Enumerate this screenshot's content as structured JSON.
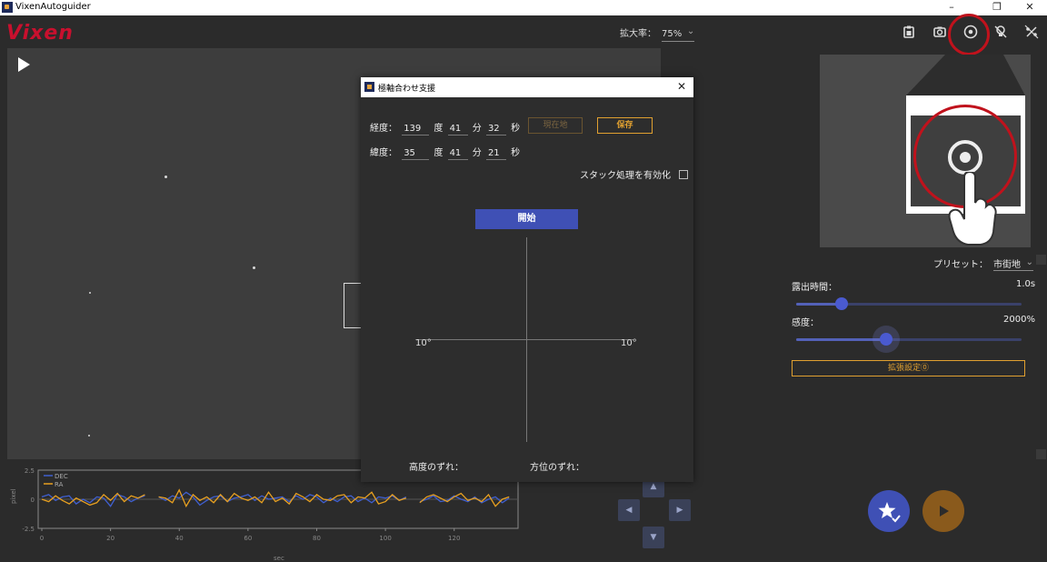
{
  "window": {
    "title": "VixenAutoguider",
    "minimize": "–",
    "maximize": "❐",
    "close": "✕"
  },
  "brand": {
    "logo": "Vixen",
    "color": "#c8102e"
  },
  "zoom": {
    "label": "拡大率：",
    "value": "75%"
  },
  "toolbar": {
    "icons": [
      "clipboard-icon",
      "camera-rotate-icon",
      "target-icon",
      "lightbulb-off-icon",
      "percent-slash-icon"
    ]
  },
  "graph": {
    "legend": [
      "DEC",
      "RA"
    ],
    "ylabel": "pixel",
    "xlabel": "sec",
    "yticks": [
      "2.5",
      "0",
      "-2.5"
    ],
    "xticks": [
      "0",
      "20",
      "40",
      "60",
      "80",
      "100",
      "120"
    ],
    "colors": {
      "DEC": "#3f5fd0",
      "RA": "#e8a020"
    }
  },
  "chart_data": {
    "type": "line",
    "xlabel": "sec",
    "ylabel": "pixel",
    "ylim": [
      -2.5,
      2.5
    ],
    "xlim": [
      0,
      137
    ],
    "series": [
      {
        "name": "DEC",
        "x": [
          0,
          2,
          4,
          6,
          8,
          10,
          12,
          14,
          16,
          18,
          20,
          22,
          24,
          26,
          28,
          30,
          34,
          36,
          38,
          40,
          42,
          44,
          46,
          48,
          50,
          52,
          54,
          56,
          58,
          60,
          62,
          64,
          66,
          68,
          70,
          72,
          74,
          76,
          78,
          80,
          82,
          84,
          86,
          88,
          90,
          92,
          94,
          96,
          98,
          100,
          102,
          104,
          106,
          110,
          112,
          114,
          116,
          118,
          120,
          122,
          124,
          126,
          128,
          130,
          132,
          134,
          136
        ],
        "values": [
          0.2,
          0.4,
          -0.1,
          0.2,
          0.3,
          -0.4,
          0.0,
          -0.3,
          0.2,
          0.1,
          -0.6,
          0.4,
          0.2,
          -0.2,
          0.1,
          0.3,
          0.2,
          -0.1,
          0.3,
          0.1,
          0.6,
          0.2,
          -0.5,
          -0.1,
          0.2,
          0.3,
          -0.2,
          0.1,
          0.2,
          0.4,
          -0.1,
          0.3,
          0.0,
          0.1,
          0.2,
          -0.2,
          0.3,
          0.0,
          0.4,
          0.2,
          -0.3,
          0.1,
          -0.2,
          0.2,
          0.3,
          -0.2,
          0.1,
          -0.3,
          0.2,
          0.1,
          0.3,
          -0.1,
          0.2,
          -0.2,
          0.0,
          0.3,
          -0.2,
          -0.1,
          0.3,
          0.0,
          -0.2,
          0.2,
          -0.3,
          0.0,
          0.2,
          -0.3,
          0.1
        ]
      },
      {
        "name": "RA",
        "x": [
          0,
          2,
          4,
          6,
          8,
          10,
          12,
          14,
          16,
          18,
          20,
          22,
          24,
          26,
          28,
          30,
          34,
          36,
          38,
          40,
          42,
          44,
          46,
          48,
          50,
          52,
          54,
          56,
          58,
          60,
          62,
          64,
          66,
          68,
          70,
          72,
          74,
          76,
          78,
          80,
          82,
          84,
          86,
          88,
          90,
          92,
          94,
          96,
          98,
          100,
          102,
          104,
          106,
          110,
          112,
          114,
          116,
          118,
          120,
          122,
          124,
          126,
          128,
          130,
          132,
          134,
          136
        ],
        "values": [
          0.0,
          -0.2,
          0.3,
          -0.1,
          -0.4,
          0.1,
          -0.2,
          -0.5,
          -0.3,
          0.4,
          -0.1,
          0.5,
          -0.2,
          0.3,
          0.1,
          0.4,
          0.2,
          0.1,
          -0.3,
          0.8,
          -0.6,
          0.4,
          -0.1,
          0.2,
          -0.3,
          0.4,
          -0.2,
          0.5,
          0.1,
          -0.1,
          0.2,
          -0.3,
          0.6,
          -0.2,
          0.1,
          -0.4,
          0.5,
          0.2,
          -0.2,
          0.4,
          0.0,
          -0.1,
          0.3,
          0.4,
          -0.3,
          0.2,
          0.1,
          0.6,
          -0.4,
          -0.2,
          0.4,
          -0.1,
          0.1,
          -0.3,
          0.2,
          0.4,
          0.1,
          -0.2,
          0.2,
          0.5,
          -0.1,
          0.1,
          -0.2,
          0.4,
          -0.6,
          0.0,
          0.2
        ]
      }
    ]
  },
  "preview": {},
  "preset": {
    "label": "プリセット：",
    "value": "市街地"
  },
  "exposure": {
    "label": "露出時間：",
    "value": "1.0s",
    "fraction": 0.2
  },
  "sensitivity": {
    "label": "感度：",
    "value": "2000%",
    "fraction": 0.4
  },
  "extended": {
    "label": "拡張設定⓪"
  },
  "dialog": {
    "title": "極軸合わせ支援",
    "longitude": {
      "label": "経度：",
      "deg": "139",
      "deg_unit": "度",
      "min": "41",
      "min_unit": "分",
      "sec": "32",
      "sec_unit": "秒"
    },
    "latitude": {
      "label": "緯度：",
      "deg": "35",
      "deg_unit": "度",
      "min": "41",
      "min_unit": "分",
      "sec": "21",
      "sec_unit": "秒"
    },
    "current_location": "現在地",
    "save": "保存",
    "stack_label": "スタック処理を有効化",
    "start": "開始",
    "left_deg": "10°",
    "right_deg": "10°",
    "altitude_offset": "高度のずれ：",
    "azimuth_offset": "方位のずれ："
  },
  "colors": {
    "accent": "#3f50b5",
    "orange": "#e0a030",
    "red_highlight": "#c0121c",
    "stop_button": "#8a5a1c"
  }
}
